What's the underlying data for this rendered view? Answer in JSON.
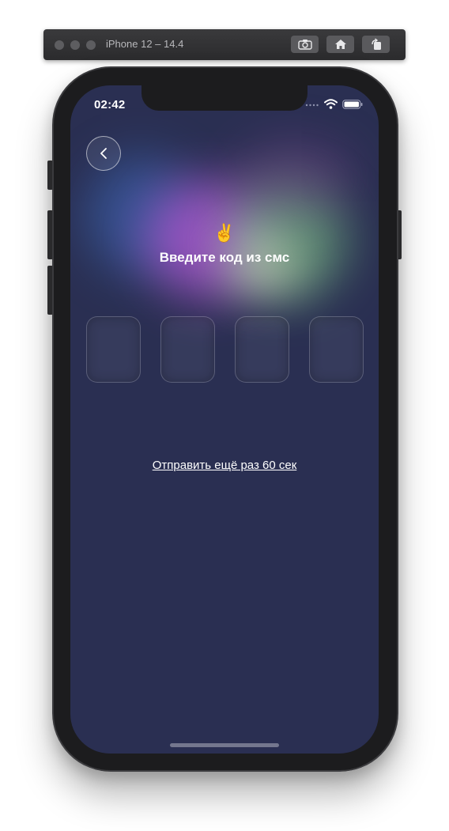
{
  "simulator": {
    "title": "iPhone 12 – 14.4",
    "buttons": [
      {
        "icon": "screenshot-icon"
      },
      {
        "icon": "home-icon"
      },
      {
        "icon": "rotate-icon"
      }
    ]
  },
  "status_bar": {
    "time": "02:42",
    "icons": [
      "cellular-icon",
      "wifi-icon",
      "battery-icon"
    ]
  },
  "header": {
    "back_icon": "chevron-left-icon"
  },
  "main": {
    "emoji": "✌️",
    "title": "Введите код из смс",
    "code_inputs": [
      "",
      "",
      "",
      ""
    ],
    "resend_label": "Отправить ещё раз 60 сек"
  },
  "colors": {
    "background": "#2a2f52",
    "glow_blue": "#3e6cc0",
    "glow_purple": "#b45ad8",
    "glow_green": "#7bc487",
    "text": "#ffffff"
  }
}
